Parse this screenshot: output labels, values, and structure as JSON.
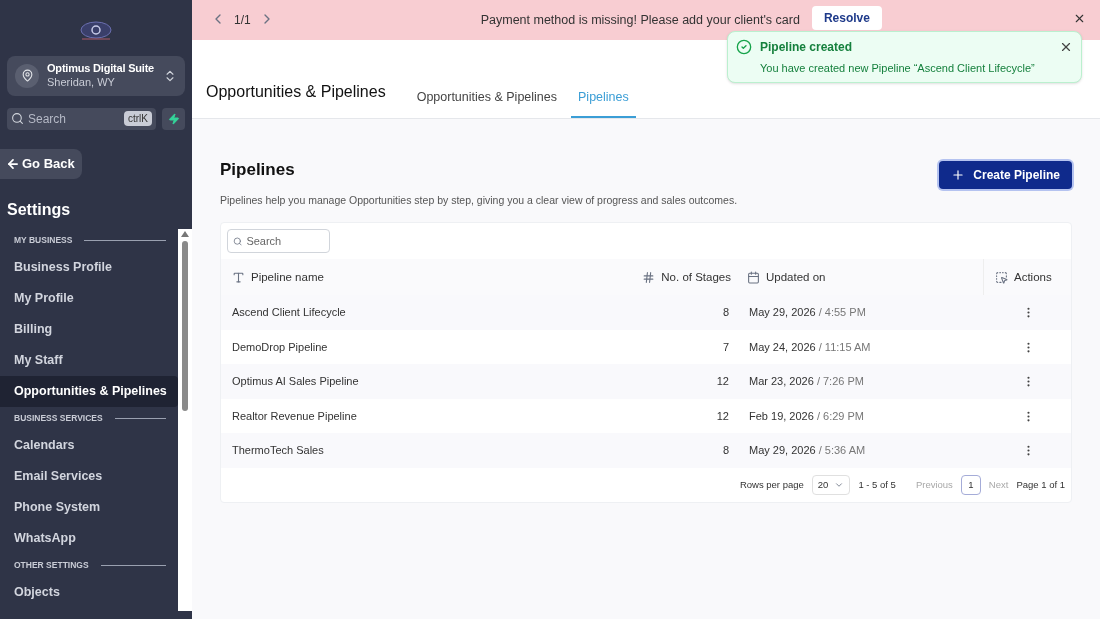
{
  "sidebar": {
    "account": {
      "name": "Optimus Digital Suite",
      "location": "Sheridan, WY"
    },
    "search": {
      "placeholder": "Search",
      "shortcut": "ctrlK"
    },
    "back": "Go Back",
    "title": "Settings",
    "sections": [
      {
        "heading": "MY BUSINESS",
        "items": [
          {
            "label": "Business Profile",
            "selected": false
          },
          {
            "label": "My Profile",
            "selected": false
          },
          {
            "label": "Billing",
            "selected": false
          },
          {
            "label": "My Staff",
            "selected": false
          },
          {
            "label": "Opportunities & Pipelines",
            "selected": true
          }
        ]
      },
      {
        "heading": "BUSINESS SERVICES",
        "items": [
          {
            "label": "Calendars",
            "selected": false
          },
          {
            "label": "Email Services",
            "selected": false
          },
          {
            "label": "Phone System",
            "selected": false
          },
          {
            "label": "WhatsApp",
            "selected": false
          }
        ]
      },
      {
        "heading": "OTHER SETTINGS",
        "items": [
          {
            "label": "Objects",
            "selected": false
          }
        ]
      }
    ]
  },
  "banner": {
    "counter": "1/1",
    "message": "Payment method is missing! Please add your client's card",
    "action": "Resolve"
  },
  "toast": {
    "title": "Pipeline created",
    "message": "You have created new Pipeline “Ascend Client Lifecycle”"
  },
  "header": {
    "title": "Opportunities & Pipelines",
    "tabs": [
      {
        "label": "Opportunities & Pipelines",
        "selected": false
      },
      {
        "label": "Pipelines",
        "selected": true
      }
    ]
  },
  "page": {
    "title": "Pipelines",
    "description": "Pipelines help you manage Opportunities step by step, giving you a clear view of progress and sales outcomes.",
    "create": "Create Pipeline"
  },
  "table": {
    "search_placeholder": "Search",
    "columns": [
      "Pipeline name",
      "No. of Stages",
      "Updated on",
      "Actions"
    ],
    "rows": [
      {
        "name": "Ascend Client Lifecycle",
        "stages": "8",
        "date": "May 29, 2026",
        "time": "/ 4:55 PM"
      },
      {
        "name": "DemoDrop Pipeline",
        "stages": "7",
        "date": "May 24, 2026",
        "time": "/ 11:15 AM"
      },
      {
        "name": "Optimus AI Sales Pipeline",
        "stages": "12",
        "date": "Mar 23, 2026",
        "time": "/ 7:26 PM"
      },
      {
        "name": "Realtor Revenue Pipeline",
        "stages": "12",
        "date": "Feb 19, 2026",
        "time": "/ 6:29 PM"
      },
      {
        "name": "ThermoTech Sales",
        "stages": "8",
        "date": "May 29, 2026",
        "time": "/ 5:36 AM"
      }
    ]
  },
  "pagination": {
    "rows_label": "Rows per page",
    "rows_value": "20",
    "range": "1 - 5 of 5",
    "previous": {
      "label": "Previous",
      "disabled": true
    },
    "page": "1",
    "next": {
      "label": "Next",
      "disabled": true
    },
    "summary": "Page 1 of 1"
  }
}
